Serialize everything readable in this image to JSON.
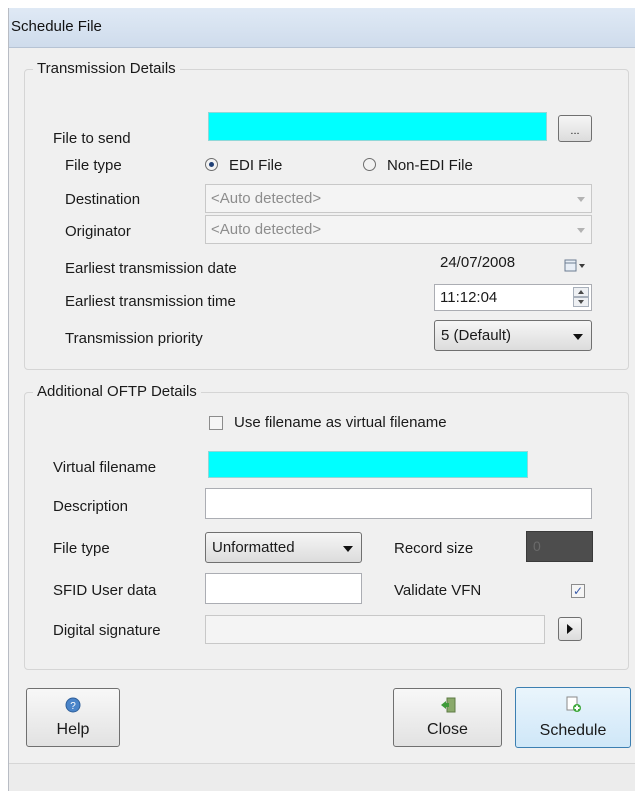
{
  "window": {
    "title": "Schedule File"
  },
  "transmission": {
    "group_title": "Transmission Details",
    "file_to_send_label": "File to send",
    "file_to_send_value": "",
    "browse_label": "...",
    "file_type_label": "File type",
    "file_type_options": [
      "EDI File",
      "Non-EDI File"
    ],
    "file_type_selected": "EDI File",
    "destination_label": "Destination",
    "destination_value": "<Auto detected>",
    "originator_label": "Originator",
    "originator_value": "<Auto detected>",
    "earliest_date_label": "Earliest transmission date",
    "earliest_date_value": "24/07/2008",
    "earliest_time_label": "Earliest transmission time",
    "earliest_time_value": "11:12:04",
    "priority_label": "Transmission priority",
    "priority_value": "5 (Default)"
  },
  "oftp": {
    "group_title": "Additional OFTP Details",
    "use_filename_label": "Use filename as virtual filename",
    "use_filename_checked": false,
    "virtual_filename_label": "Virtual filename",
    "virtual_filename_value": "",
    "description_label": "Description",
    "description_value": "",
    "file_type_label": "File type",
    "file_type_value": "Unformatted",
    "record_size_label": "Record size",
    "record_size_value": "0",
    "sfid_label": "SFID User data",
    "sfid_value": "",
    "validate_vfn_label": "Validate VFN",
    "validate_vfn_checked": true,
    "digital_signature_label": "Digital signature",
    "digital_signature_value": ""
  },
  "buttons": {
    "help": "Help",
    "close": "Close",
    "schedule": "Schedule"
  },
  "colors": {
    "required_field": "#00ffff",
    "accent": "#3c7fb1"
  },
  "icons": [
    "calendar-icon",
    "spinner-icon",
    "help-icon",
    "close-door-icon",
    "schedule-add-icon"
  ]
}
